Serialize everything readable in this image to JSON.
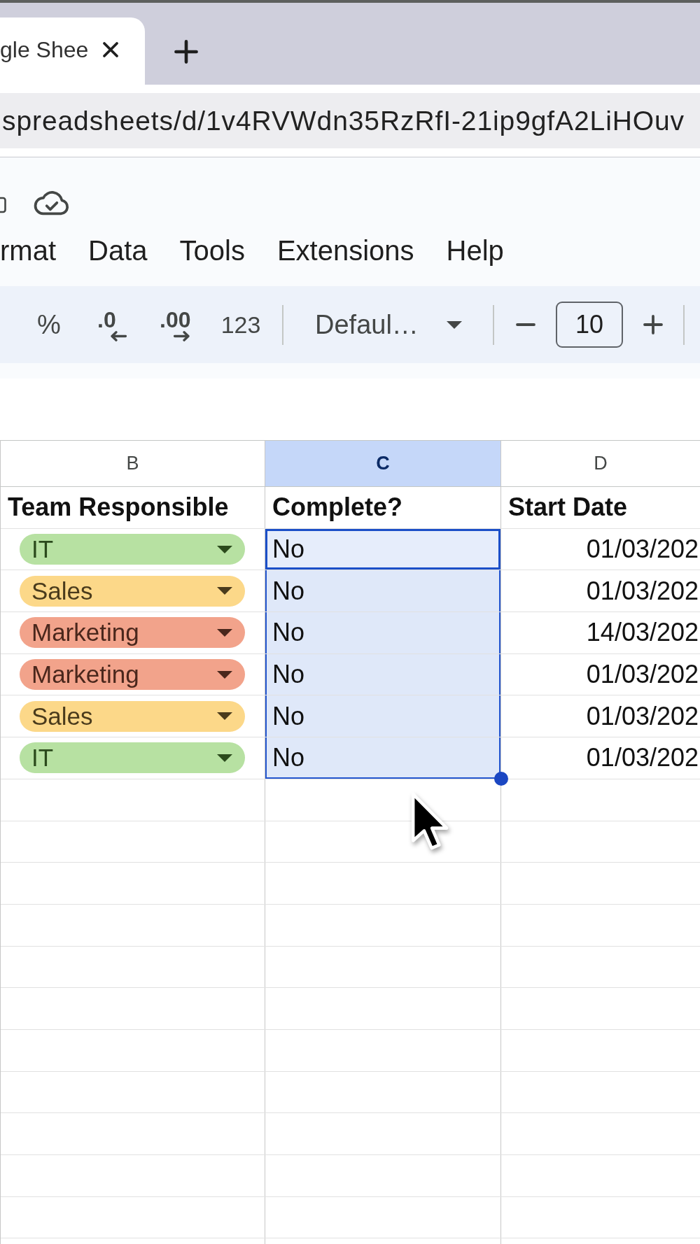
{
  "browser": {
    "tab_title": "gle Shee",
    "address": "spreadsheets/d/1v4RVWdn35RzRfI-21ip9gfA2LiHOuv"
  },
  "menu": [
    "rmat",
    "Data",
    "Tools",
    "Extensions",
    "Help"
  ],
  "toolbar": {
    "percent": "%",
    "decrease_decimal": ".0",
    "increase_decimal": ".00",
    "number_format": "123",
    "font": "Defaul…",
    "font_size": "10"
  },
  "sheet": {
    "columns": [
      {
        "letter": "B",
        "selected": false
      },
      {
        "letter": "C",
        "selected": true
      },
      {
        "letter": "D",
        "selected": false
      }
    ],
    "headers": [
      "Team Responsible",
      "Complete?",
      "Start Date"
    ],
    "rows": [
      {
        "team": {
          "label": "IT",
          "color": "#b7e1a2"
        },
        "complete": {
          "value": "No",
          "selected": true,
          "active": true
        },
        "start_date": "01/03/202"
      },
      {
        "team": {
          "label": "Sales",
          "color": "#fcd889"
        },
        "complete": {
          "value": "No",
          "selected": true,
          "active": false
        },
        "start_date": "01/03/202"
      },
      {
        "team": {
          "label": "Marketing",
          "color": "#f2a38b"
        },
        "complete": {
          "value": "No",
          "selected": true,
          "active": false
        },
        "start_date": "14/03/202"
      },
      {
        "team": {
          "label": "Marketing",
          "color": "#f2a38b"
        },
        "complete": {
          "value": "No",
          "selected": true,
          "active": false
        },
        "start_date": "01/03/202"
      },
      {
        "team": {
          "label": "Sales",
          "color": "#fcd889"
        },
        "complete": {
          "value": "No",
          "selected": true,
          "active": false
        },
        "start_date": "01/03/202"
      },
      {
        "team": {
          "label": "IT",
          "color": "#b7e1a2"
        },
        "complete": {
          "value": "No",
          "selected": true,
          "active": false
        },
        "start_date": "01/03/202"
      }
    ]
  }
}
